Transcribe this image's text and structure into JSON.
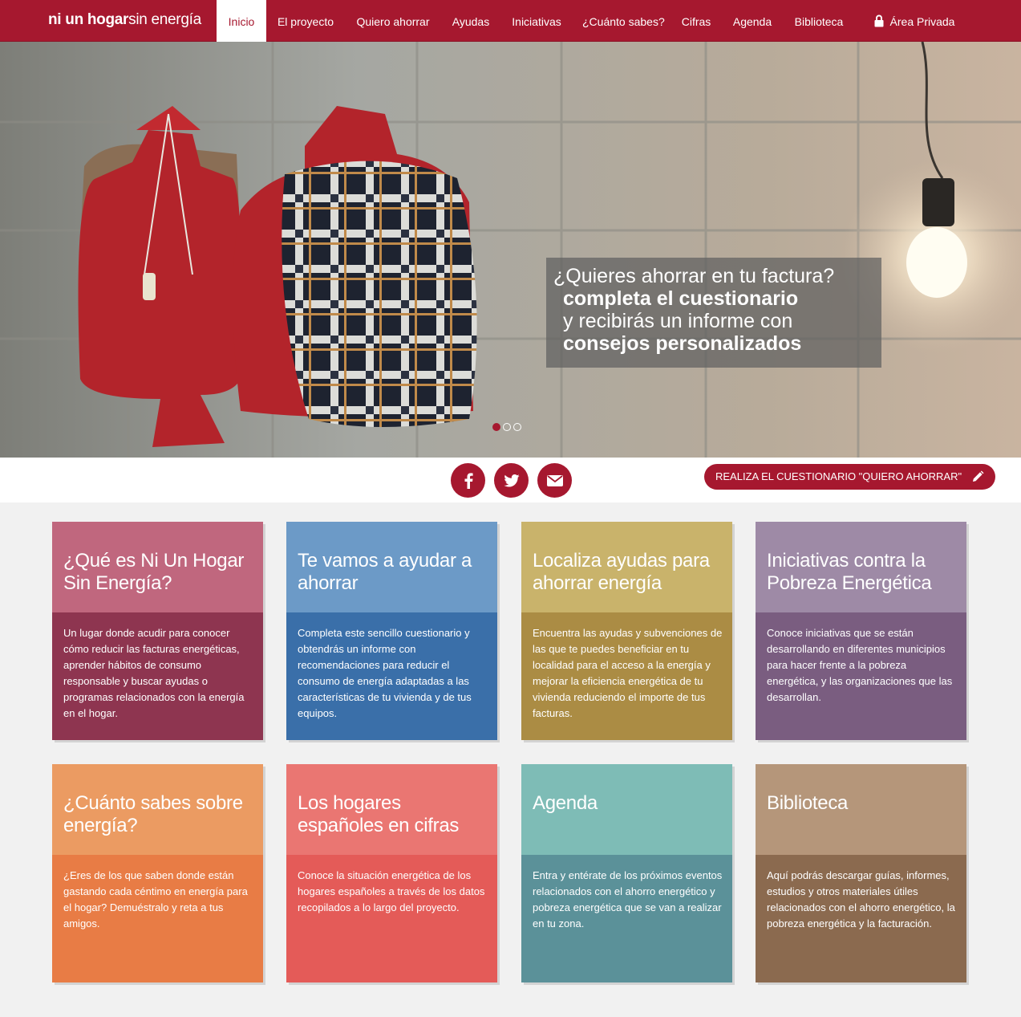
{
  "brand": {
    "bold": "ni un hogar",
    "light": "sin energía"
  },
  "nav": {
    "items": [
      {
        "label": "Inicio",
        "active": true
      },
      {
        "label": "El proyecto"
      },
      {
        "label": "Quiero ahorrar"
      },
      {
        "label": "Ayudas"
      },
      {
        "label": "Iniciativas"
      },
      {
        "label": "¿Cuánto sabes?"
      },
      {
        "label": "Cifras"
      },
      {
        "label": "Agenda"
      },
      {
        "label": "Biblioteca"
      }
    ],
    "private": {
      "label": "Área Privada",
      "icon": "lock-icon"
    }
  },
  "hero": {
    "line1": "¿Quieres ahorrar en tu factura?",
    "line2": "completa el cuestionario",
    "line3": "y recibirás un informe con",
    "line4": "consejos personalizados",
    "slides": 3,
    "active_slide": 1
  },
  "share": {
    "icons": [
      "facebook-icon",
      "twitter-icon",
      "envelope-icon"
    ],
    "cta_label": "REALIZA EL CUESTIONARIO \"QUIERO AHORRAR\"",
    "cta_icon": "pencil-icon"
  },
  "colors": {
    "brand": "#a6182f",
    "white": "#ffffff",
    "page_bg": "#f1f1f1"
  },
  "cards": [
    {
      "title": "¿Qué es Ni Un Hogar Sin Energía?",
      "text": "Un lugar donde acudir para conocer cómo reducir las facturas energéticas, aprender hábitos de consumo responsable y buscar ayudas o programas relacionados con la energía en el hogar.",
      "head_color": "#c0677e",
      "body_color": "#8e3550"
    },
    {
      "title": "Te vamos a ayudar a ahorrar",
      "text": "Completa este sencillo cuestionario y obtendrás un informe con recomendaciones para reducir el consumo de energía adaptadas a las características de tu vivienda y de tus equipos.",
      "head_color": "#6c9ac7",
      "body_color": "#3a6fa9"
    },
    {
      "title": "Localiza ayudas para ahorrar energía",
      "text": "Encuentra las ayudas y subvenciones de las que te puedes beneficiar en tu localidad para el acceso a la energía y mejorar la eficiencia energética de tu vivienda reduciendo el importe de tus facturas.",
      "head_color": "#c9b36b",
      "body_color": "#ab8c44"
    },
    {
      "title": "Iniciativas contra la Pobreza Energética",
      "text": "Conoce iniciativas que se están desarrollando en diferentes municipios para hacer frente a la pobreza energética, y las organizaciones que las desarrollan.",
      "head_color": "#9e8aa6",
      "body_color": "#7a5d80"
    },
    {
      "title": "¿Cuánto sabes sobre energía?",
      "text": "¿Eres de los que saben donde están gastando cada céntimo en energía para el hogar? Demuéstralo y reta a tus amigos.",
      "head_color": "#eb9b62",
      "body_color": "#e87c45"
    },
    {
      "title": "Los hogares españoles en cifras",
      "text": "Conoce la situación energética de los hogares españoles a través de los datos recopilados a lo largo del proyecto.",
      "head_color": "#ea7672",
      "body_color": "#e45b58"
    },
    {
      "title": "Agenda",
      "text": "Entra y entérate de los próximos eventos relacionados con el ahorro energético y pobreza energética que se van a realizar en tu zona.",
      "head_color": "#7ebcb6",
      "body_color": "#5b9199"
    },
    {
      "title": "Biblioteca",
      "text": "Aquí podrás descargar guías, informes, estudios y otros materiales útiles relacionados con el ahorro energético, la pobreza energética y la facturación.",
      "head_color": "#b5967a",
      "body_color": "#8b6a4f"
    }
  ]
}
